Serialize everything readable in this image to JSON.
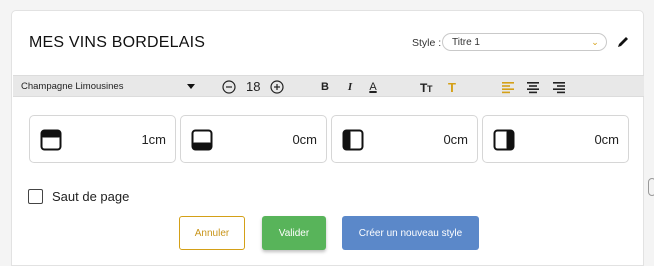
{
  "header": {
    "title": "MES VINS BORDELAIS",
    "style_label": "Style :",
    "style_value": "Titre 1"
  },
  "toolbar": {
    "font_name": "Champagne Limousines",
    "font_size": "18",
    "bold": "B",
    "italic": "I",
    "text_color": "A"
  },
  "margins": [
    {
      "side": "top",
      "value": "1cm"
    },
    {
      "side": "bottom",
      "value": "0cm"
    },
    {
      "side": "left",
      "value": "0cm"
    },
    {
      "side": "right",
      "value": "0cm"
    }
  ],
  "page_break": {
    "label": "Saut de page",
    "checked": false
  },
  "buttons": {
    "cancel": "Annuler",
    "validate": "Valider",
    "create_style": "Créer un nouveau style"
  },
  "colors": {
    "accent_gold": "#d4a017",
    "validate_green": "#58b45a",
    "create_blue": "#5b88c9"
  }
}
